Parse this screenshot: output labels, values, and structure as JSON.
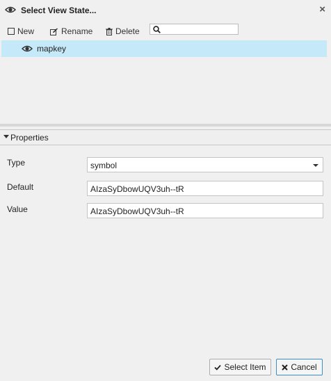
{
  "dialog": {
    "title": "Select View State..."
  },
  "toolbar": {
    "new_label": "New",
    "rename_label": "Rename",
    "delete_label": "Delete",
    "search_value": ""
  },
  "list": {
    "items": [
      {
        "label": "mapkey",
        "icon": "eye-icon",
        "selected": true
      }
    ]
  },
  "properties": {
    "header": "Properties",
    "type_label": "Type",
    "type_value": "symbol",
    "default_label": "Default",
    "default_value": "AIzaSyDbowUQV3uh--tR",
    "value_label": "Value",
    "value_value": "AIzaSyDbowUQV3uh--tR"
  },
  "footer": {
    "select_label": "Select Item",
    "cancel_label": "Cancel"
  },
  "colors": {
    "selection": "#c5e9f8",
    "focus_border": "#3a8fc8",
    "background": "#f0f0f0"
  }
}
